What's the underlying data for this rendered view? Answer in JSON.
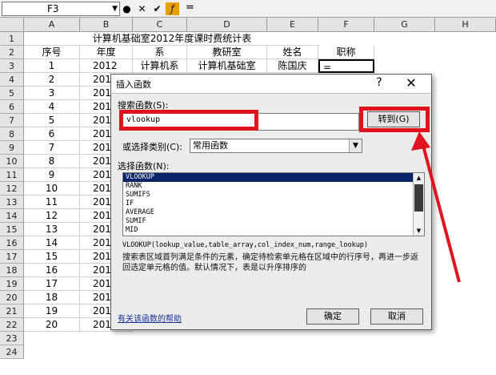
{
  "formula_bar": {
    "cell_ref": "F3",
    "icons": [
      "dropdown-icon",
      "circle-icon",
      "cancel-x-icon",
      "check-icon",
      "function-icon"
    ],
    "equals": "=",
    "value": ""
  },
  "columns": [
    "A",
    "B",
    "C",
    "D",
    "E",
    "F",
    "G",
    "H"
  ],
  "rows": [
    "1",
    "2",
    "3",
    "4",
    "5",
    "6",
    "7",
    "8",
    "9",
    "10",
    "11",
    "12",
    "13",
    "14",
    "15",
    "16",
    "17",
    "18",
    "19",
    "20",
    "21",
    "22",
    "23",
    "24"
  ],
  "sheet": {
    "title": "计算机基础室2012年度课时费统计表",
    "headers": [
      "序号",
      "年度",
      "系",
      "教研室",
      "姓名",
      "职称"
    ],
    "row3": [
      "1",
      "2012",
      "计算机系",
      "计算机基础室",
      "陈国庆",
      "="
    ],
    "serials": [
      "1",
      "2",
      "3",
      "4",
      "5",
      "6",
      "7",
      "8",
      "9",
      "10",
      "11",
      "12",
      "13",
      "14",
      "15",
      "16",
      "17",
      "18",
      "19",
      "20"
    ],
    "year_prefix": "201"
  },
  "dialog": {
    "title": "插入函数",
    "help_glyph": "?",
    "close_glyph": "✕",
    "search_label": "搜索函数(S):",
    "search_value": "vlookup",
    "go_button": "转到(G)",
    "category_label": "或选择类别(C):",
    "category_value": "常用函数",
    "functions_label": "选择函数(N):",
    "functions": [
      "VLOOKUP",
      "RANK",
      "SUMIFS",
      "IF",
      "AVERAGE",
      "SUMIF",
      "MID"
    ],
    "selected_function": "VLOOKUP",
    "signature": "VLOOKUP(lookup_value,table_array,col_index_num,range_lookup)",
    "description": "搜索表区域首列满足条件的元素，确定待检索单元格在区域中的行序号，再进一步返回选定单元格的值。默认情况下，表是以升序排序的",
    "help_link": "有关该函数的帮助",
    "ok_button": "确定",
    "cancel_button": "取消"
  },
  "annotation_color": "#e0141e"
}
